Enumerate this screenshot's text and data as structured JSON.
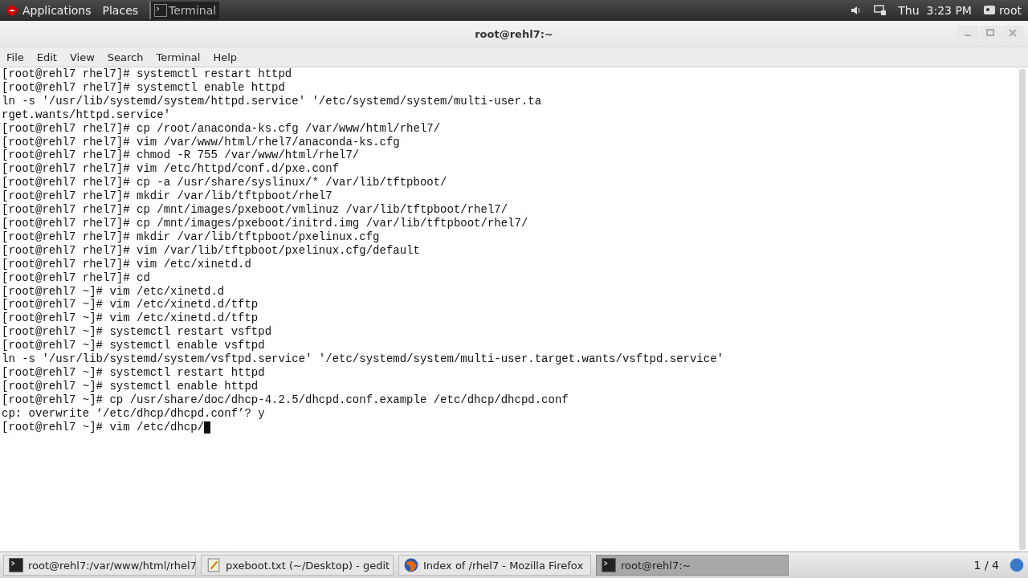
{
  "top_bar": {
    "menus": [
      "Applications",
      "Places"
    ],
    "active_app": "Terminal",
    "clock": "Thu  3:23 PM",
    "user": "root"
  },
  "window": {
    "title": "root@rehl7:~"
  },
  "menu_bar": [
    "File",
    "Edit",
    "View",
    "Search",
    "Terminal",
    "Help"
  ],
  "terminal": {
    "lines": [
      "[root@rehl7 rhel7]# systemctl restart httpd",
      "[root@rehl7 rhel7]# systemctl enable httpd",
      "ln -s '/usr/lib/systemd/system/httpd.service' '/etc/systemd/system/multi-user.ta",
      "rget.wants/httpd.service'",
      "[root@rehl7 rhel7]# cp /root/anaconda-ks.cfg /var/www/html/rhel7/",
      "[root@rehl7 rhel7]# vim /var/www/html/rhel7/anaconda-ks.cfg",
      "[root@rehl7 rhel7]# chmod -R 755 /var/www/html/rhel7/",
      "[root@rehl7 rhel7]# vim /etc/httpd/conf.d/pxe.conf",
      "[root@rehl7 rhel7]# cp -a /usr/share/syslinux/* /var/lib/tftpboot/",
      "[root@rehl7 rhel7]# mkdir /var/lib/tftpboot/rhel7",
      "[root@rehl7 rhel7]# cp /mnt/images/pxeboot/vmlinuz /var/lib/tftpboot/rhel7/",
      "[root@rehl7 rhel7]# cp /mnt/images/pxeboot/initrd.img /var/lib/tftpboot/rhel7/",
      "[root@rehl7 rhel7]# mkdir /var/lib/tftpboot/pxelinux.cfg",
      "[root@rehl7 rhel7]# vim /var/lib/tftpboot/pxelinux.cfg/default",
      "[root@rehl7 rhel7]# vim /etc/xinetd.d",
      "[root@rehl7 rhel7]# cd",
      "[root@rehl7 ~]# vim /etc/xinetd.d",
      "[root@rehl7 ~]# vim /etc/xinetd.d/tftp",
      "[root@rehl7 ~]# vim /etc/xinetd.d/tftp",
      "[root@rehl7 ~]# systemctl restart vsftpd",
      "[root@rehl7 ~]# systemctl enable vsftpd",
      "ln -s '/usr/lib/systemd/system/vsftpd.service' '/etc/systemd/system/multi-user.target.wants/vsftpd.service'",
      "[root@rehl7 ~]# systemctl restart httpd",
      "[root@rehl7 ~]# systemctl enable httpd",
      "[root@rehl7 ~]# cp /usr/share/doc/dhcp-4.2.5/dhcpd.conf.example /etc/dhcp/dhcpd.conf",
      "cp: overwrite ‘/etc/dhcp/dhcpd.conf’? y"
    ],
    "prompt": "[root@rehl7 ~]# vim /etc/dhcp/"
  },
  "taskbar": {
    "items": [
      {
        "kind": "terminal",
        "label": "root@rehl7:/var/www/html/rhel7",
        "selected": false
      },
      {
        "kind": "editor",
        "label": "pxeboot.txt (~/Desktop) - gedit",
        "selected": false
      },
      {
        "kind": "browser",
        "label": "Index of /rhel7 - Mozilla Firefox",
        "selected": false
      },
      {
        "kind": "terminal",
        "label": "root@rehl7:~",
        "selected": true
      }
    ],
    "workspace": "1 / 4"
  }
}
